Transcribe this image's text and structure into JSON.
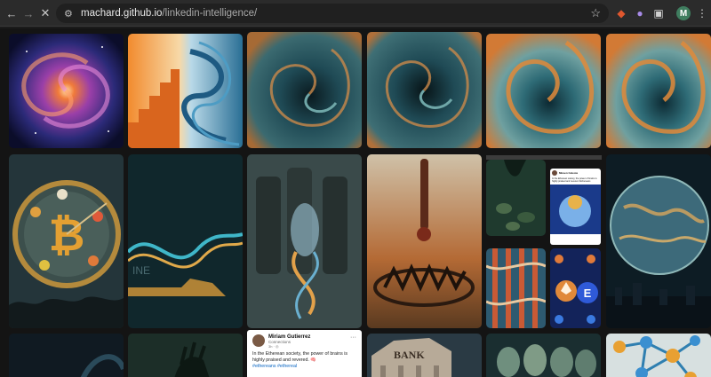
{
  "browser": {
    "url_host": "machard.github.io",
    "url_path": "/linkedin-intelligence/",
    "back_icon": "arrow-left-icon",
    "forward_icon": "arrow-right-icon",
    "stop_icon": "close-icon",
    "site_info_icon": "tune-icon",
    "bookmark_icon": "star-icon",
    "extensions": [
      "maple-leaf-icon",
      "spy-icon",
      "puzzle-icon"
    ],
    "profile_initial": "M",
    "menu_icon": "more-vert-icon"
  },
  "gallery": {
    "featured_post": {
      "author": "Miriam Gutierrez",
      "subtitle": "Connections",
      "meta": "3h · ◎",
      "body": "In the Etherean society, the power of brains is highly praised and revered. 🧠",
      "tags": "#ethereans #ethereal",
      "menu": "···"
    },
    "small_post": {
      "author": "Mireen Celeste",
      "lines": [
        "In the Etherean society, the power of brains is",
        "highly praised and revered. #ethereans"
      ]
    },
    "coin_letter": "E",
    "bank_sign": "BANK"
  }
}
